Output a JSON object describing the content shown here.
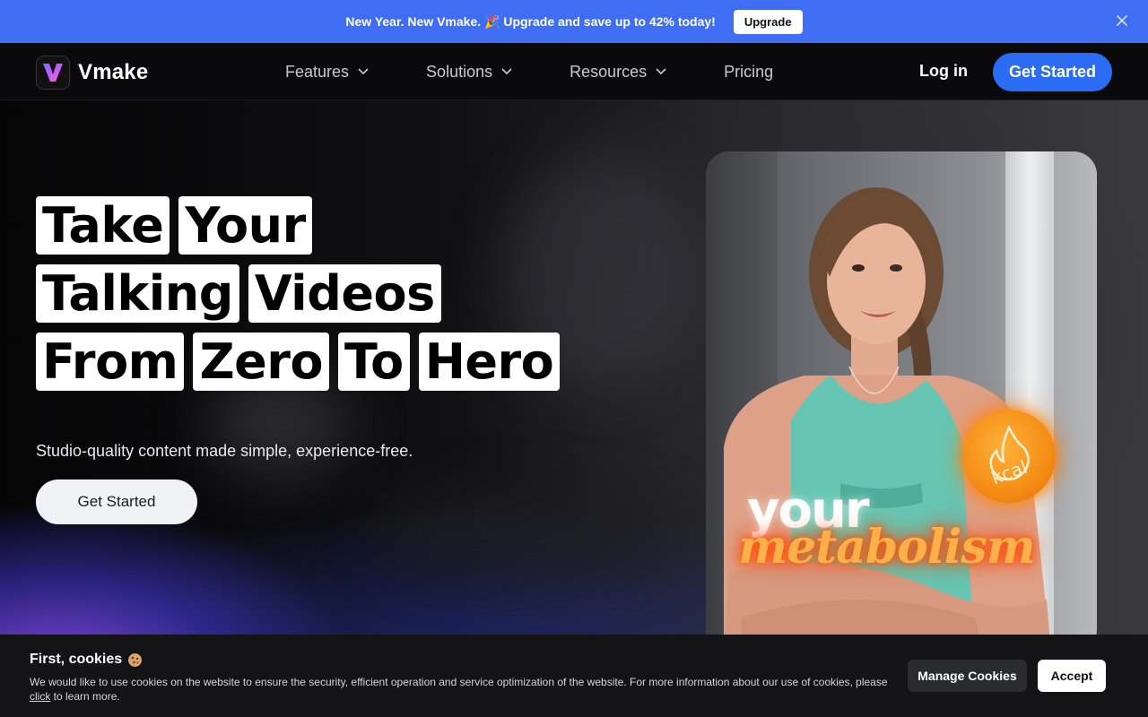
{
  "promo": {
    "text": "New Year. New Vmake. 🎉 Upgrade and save up to 42% today!",
    "button_label": "Upgrade",
    "close_icon": "close-icon"
  },
  "nav": {
    "brand": "Vmake",
    "links": [
      {
        "label": "Features",
        "has_dropdown": true
      },
      {
        "label": "Solutions",
        "has_dropdown": true
      },
      {
        "label": "Resources",
        "has_dropdown": true
      },
      {
        "label": "Pricing",
        "has_dropdown": false
      }
    ],
    "login_label": "Log in",
    "cta_label": "Get Started"
  },
  "hero": {
    "headline_rows": [
      [
        "Take",
        "Your"
      ],
      [
        "Talking",
        "Videos"
      ],
      [
        "From",
        "Zero",
        "To",
        "Hero"
      ]
    ],
    "subtitle": "Studio-quality content made simple, experience-free.",
    "cta_label": "Get Started",
    "video_overlay": {
      "line1": "your",
      "line2": "metabolism",
      "badge": "kcal"
    }
  },
  "cookie": {
    "title": "First, cookies",
    "text_before_link": "We would like to use cookies on the website to ensure the security, efficient operation and service optimization of the website. For more information about our use of cookies, please ",
    "link_text": "click",
    "text_after_link": " to learn more.",
    "manage_label": "Manage Cookies",
    "accept_label": "Accept"
  },
  "colors": {
    "promo_bg": "#3f6ef5",
    "cta_blue": "#2a6df4",
    "nav_bg": "#0a0a0c",
    "cookie_bg": "#141416"
  }
}
